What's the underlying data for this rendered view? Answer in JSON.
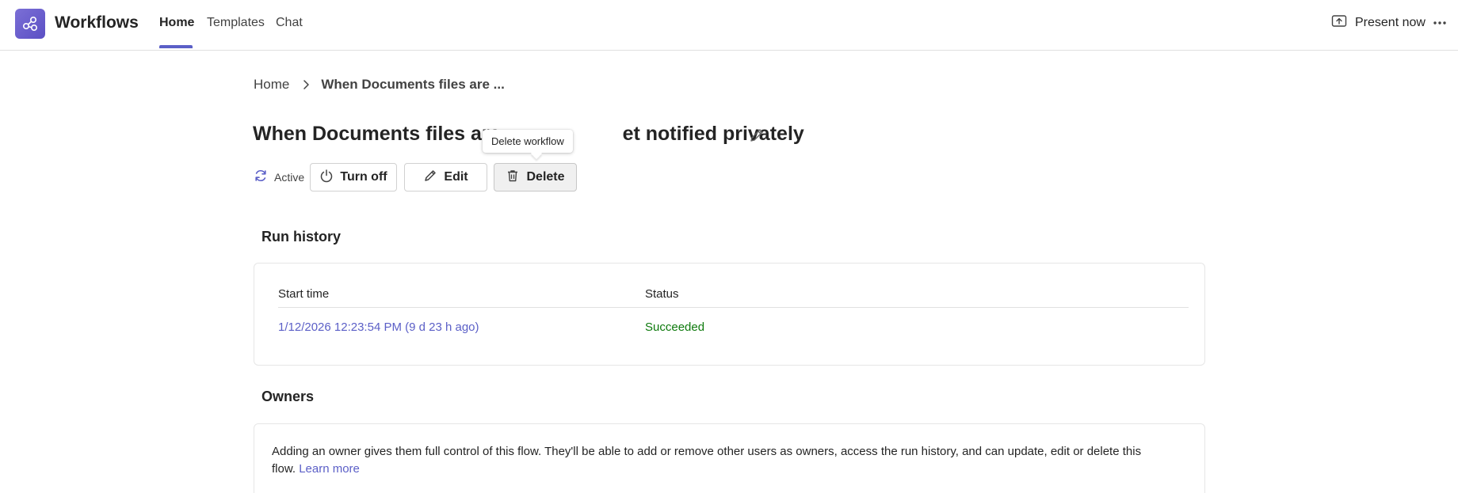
{
  "header": {
    "app_title": "Workflows",
    "tabs": [
      {
        "label": "Home",
        "active": true
      },
      {
        "label": "Templates",
        "active": false
      },
      {
        "label": "Chat",
        "active": false
      }
    ],
    "present_label": "Present now",
    "more_icon": "more-horizontal-icon",
    "accent_color": "#5b5fc7"
  },
  "breadcrumb": {
    "home": "Home",
    "current": "When Documents files are ..."
  },
  "workflow": {
    "title": "When Documents files are created, get notified privately",
    "title_visible": "When Documents files are",
    "title_visible_end": "et notified privately",
    "status": "Active",
    "actions": {
      "turn_off": "Turn off",
      "edit": "Edit",
      "delete": "Delete"
    },
    "tooltip": "Delete workflow"
  },
  "run_history": {
    "title": "Run history",
    "columns": [
      "Start time",
      "Status"
    ],
    "rows": [
      {
        "start_time": "1/12/2026 12:23:54 PM (9 d 23 h ago)",
        "status": "Succeeded"
      }
    ],
    "success_color": "#0e7a0d"
  },
  "owners": {
    "title": "Owners",
    "description_line1": "Adding an owner gives them full control of this flow. They'll be able to add or remove other users as owners, access the run history, and can update, edit or delete this",
    "description_line2": "flow.",
    "learn_more": "Learn more"
  }
}
